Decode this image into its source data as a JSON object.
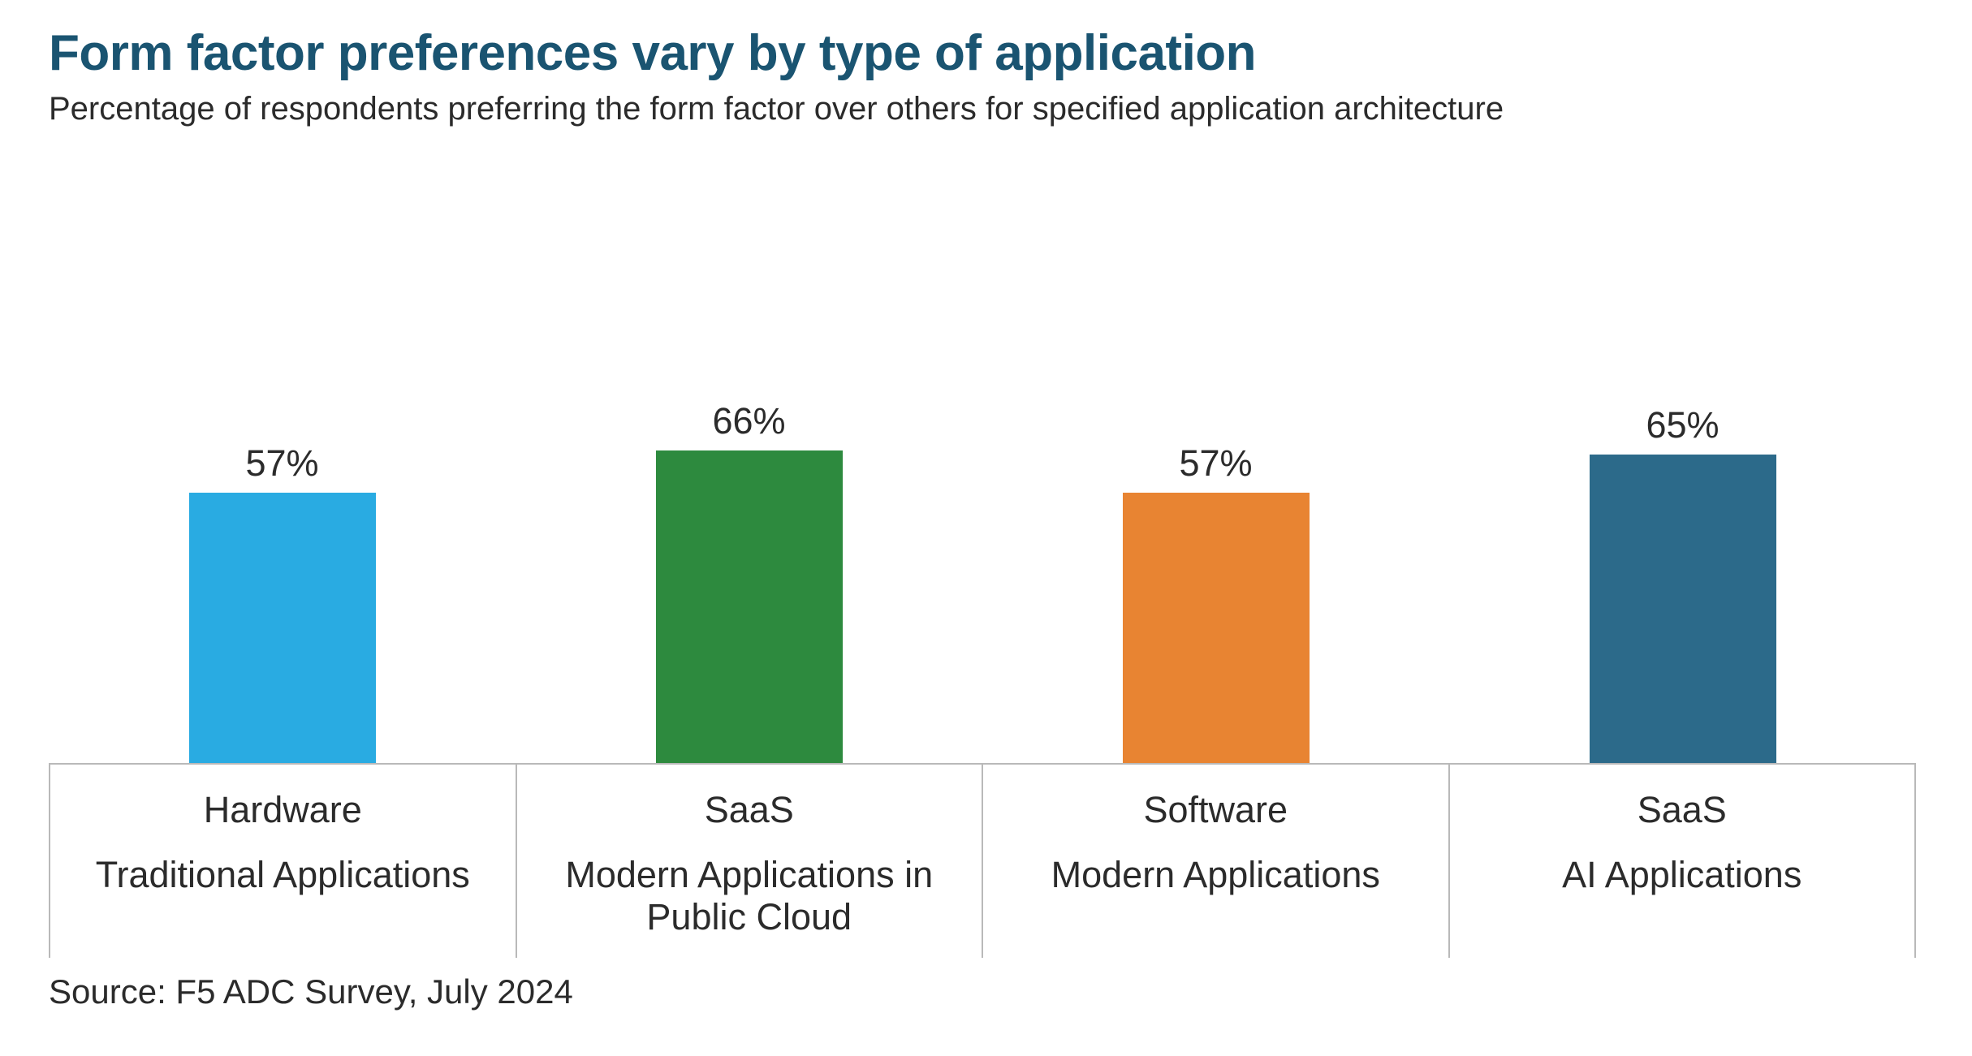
{
  "title": "Form factor preferences vary by type of application",
  "subtitle": "Percentage of respondents preferring the form factor over others for specified application architecture",
  "source": "Source: F5 ADC Survey, July 2024",
  "colors": {
    "title": "#1a5471",
    "text": "#2b2b2b",
    "grid": "#b9b9b9"
  },
  "chart_data": {
    "type": "bar",
    "ylabel": "",
    "xlabel": "",
    "ylim": [
      0,
      100
    ],
    "bars": [
      {
        "value": 57,
        "label": "57%",
        "form_factor": "Hardware",
        "category": "Traditional Applications",
        "color": "#29abe2"
      },
      {
        "value": 66,
        "label": "66%",
        "form_factor": "SaaS",
        "category": "Modern Applications in Public Cloud",
        "color": "#2d8a3e"
      },
      {
        "value": 57,
        "label": "57%",
        "form_factor": "Software",
        "category": "Modern Applications",
        "color": "#e88432"
      },
      {
        "value": 65,
        "label": "65%",
        "form_factor": "SaaS",
        "category": "AI Applications",
        "color": "#2c6a8a"
      }
    ]
  }
}
